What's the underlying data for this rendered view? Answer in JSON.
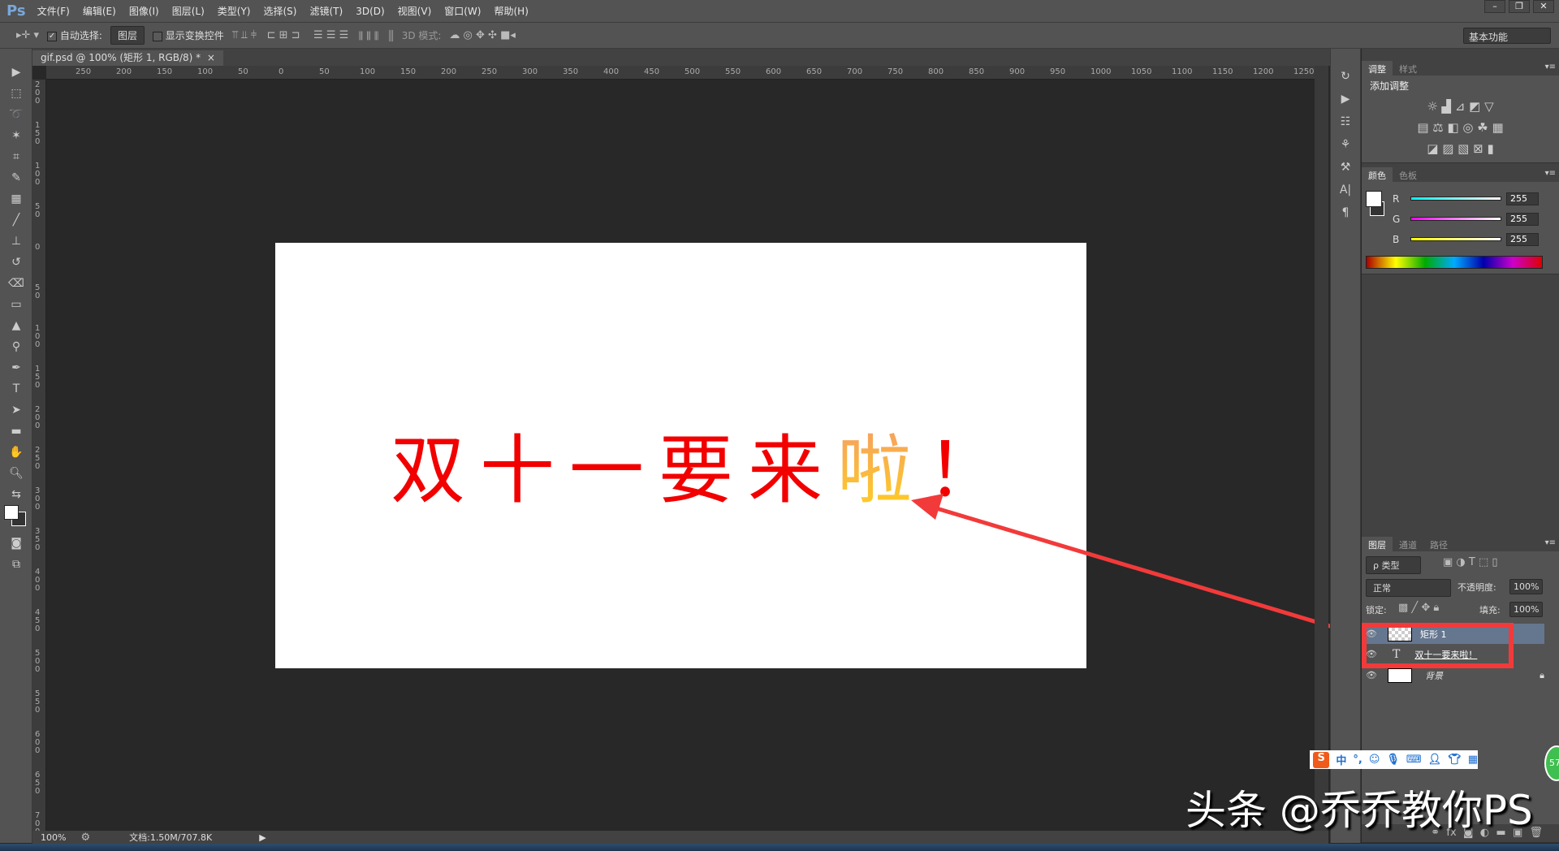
{
  "app": {
    "logo": "Ps",
    "workspace": "基本功能"
  },
  "menu": [
    "文件(F)",
    "编辑(E)",
    "图像(I)",
    "图层(L)",
    "类型(Y)",
    "选择(S)",
    "滤镜(T)",
    "3D(D)",
    "视图(V)",
    "窗口(W)",
    "帮助(H)"
  ],
  "options": {
    "auto_select_label": "自动选择:",
    "auto_select_checked": true,
    "auto_select_target": "图层",
    "show_transform_label": "显示变换控件",
    "show_transform_checked": false,
    "mode_3d_label": "3D 模式:"
  },
  "document": {
    "tab_title": "gif.psd @ 100% (矩形 1, RGB/8) *",
    "close": "×",
    "headline_main": "双十一要来",
    "headline_grad": "啦",
    "headline_end": "！",
    "text_color": "#f20000"
  },
  "ruler": {
    "h": [
      "250",
      "200",
      "150",
      "100",
      "50",
      "0",
      "50",
      "100",
      "150",
      "200",
      "250",
      "300",
      "350",
      "400",
      "450",
      "500",
      "550",
      "600",
      "650",
      "700",
      "750",
      "800",
      "850",
      "900",
      "950",
      "1000",
      "1050",
      "1100",
      "1150",
      "1200",
      "1250"
    ],
    "v": [
      "200",
      "150",
      "100",
      "50",
      "0",
      "50",
      "100",
      "150",
      "200",
      "250",
      "300",
      "350",
      "400",
      "450",
      "500",
      "550",
      "600",
      "650",
      "700"
    ]
  },
  "status": {
    "zoom": "100%",
    "doc_size": "文档:1.50M/707.8K"
  },
  "adjustments": {
    "tabs": [
      "调整",
      "样式"
    ],
    "title": "添加调整"
  },
  "color": {
    "tabs": [
      "颜色",
      "色板"
    ],
    "channels": [
      {
        "label": "R",
        "value": "255"
      },
      {
        "label": "G",
        "value": "255"
      },
      {
        "label": "B",
        "value": "255"
      }
    ]
  },
  "layers": {
    "tabs": [
      "图层",
      "通道",
      "路径"
    ],
    "filter": "ρ 类型",
    "blend_mode": "正常",
    "opacity_label": "不透明度:",
    "opacity": "100%",
    "lock_label": "锁定:",
    "fill_label": "填充:",
    "fill": "100%",
    "items": [
      {
        "name": "矩形 1",
        "selected": true
      },
      {
        "name": "双十一要来啦！",
        "type": "text"
      },
      {
        "name": "背景",
        "locked": true
      }
    ]
  },
  "ime": {
    "logo": "S",
    "mode": "中",
    "punct": "°,"
  },
  "watermark": "头条 @乔乔教你PS",
  "badge": "57"
}
